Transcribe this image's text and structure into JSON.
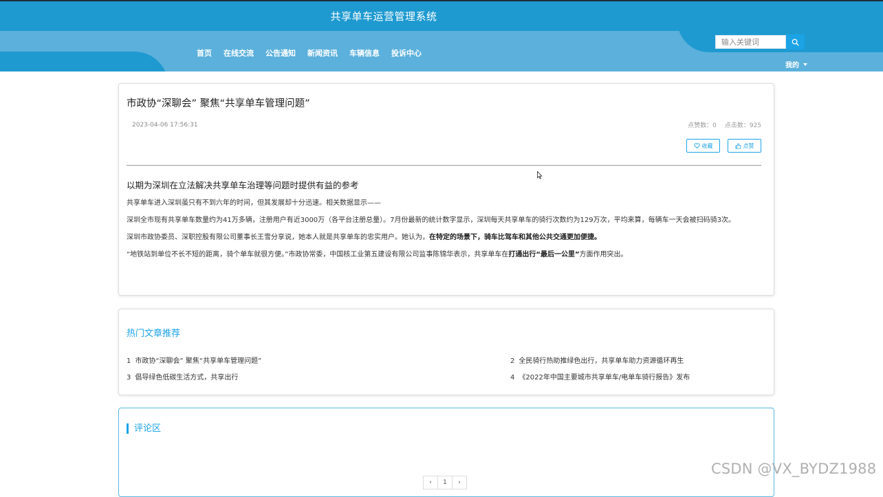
{
  "header": {
    "title": "共享单车运营管理系统",
    "nav": [
      "首页",
      "在线交流",
      "公告通知",
      "新闻资讯",
      "车辆信息",
      "投诉中心"
    ],
    "search_placeholder": "输入关键词",
    "user_menu": "我的"
  },
  "article": {
    "title": "市政协“深聊会” 聚焦“共享单车管理问题”",
    "time": "2023-04-06 17:56:31",
    "likes_label": "点赞数：0",
    "clicks_label": "点击数：925",
    "collect_label": "收藏",
    "like_label": "点赞",
    "subtitle": "以期为深圳在立法解决共享单车治理等问题时提供有益的参考",
    "p1": "共享单车进入深圳虽只有不到六年的时间，但其发展却十分迅速。相关数据显示——",
    "p2": "深圳全市现有共享单车数量约为41万多辆，注册用户有近3000万（各平台注册总量）。7月份最新的统计数字显示，深圳每天共享单车的骑行次数约为129万次，平均来算，每辆车一天会被扫码骑3次。",
    "p3_a": "深圳市政协委员、深职控股有限公司董事长王雪分享说，她本人就是共享单车的忠实用户。她认为，",
    "p3_b": "在特定的场景下，骑车比驾车和其他公共交通更加便捷。",
    "p4_a": "“地铁站到单位不长不短的距离，骑个单车就很方便。”市政协常委，中国核工业第五建设有限公司监事陈锦华表示，共享单车在",
    "p4_b": "打通出行“最后一公里”",
    "p4_c": "方面作用突出。"
  },
  "hot": {
    "title": "热门文章推荐",
    "items": [
      {
        "num": "1",
        "text": "市政协“深聊会” 聚焦“共享单车管理问题”"
      },
      {
        "num": "2",
        "text": "全民骑行热助推绿色出行，共享单车助力资源循环再生"
      },
      {
        "num": "3",
        "text": "倡导绿色低碳生活方式，共享出行"
      },
      {
        "num": "4",
        "text": "《2022年中国主要城市共享单车/电单车骑行报告》发布"
      }
    ]
  },
  "comments": {
    "title": "评论区",
    "pager": [
      "‹",
      "1",
      "›"
    ]
  },
  "watermark": "CSDN @VX_BYDZ1988",
  "colors": {
    "primary": "#1e9ad0",
    "accent": "#1ba3e6",
    "band_light": "#5bb0dc"
  }
}
